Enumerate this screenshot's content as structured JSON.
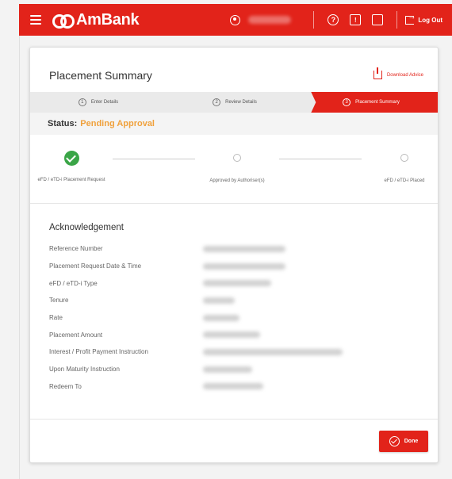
{
  "header": {
    "brand": "AmBank",
    "logout_label": "Log Out",
    "help_glyph": "?",
    "book_glyph": "!"
  },
  "page": {
    "title": "Placement Summary",
    "download_label": "Download Advice"
  },
  "stepper": [
    {
      "num": "1",
      "label": "Enter Details"
    },
    {
      "num": "2",
      "label": "Review Details"
    },
    {
      "num": "3",
      "label": "Placement Summary"
    }
  ],
  "status": {
    "label": "Status:",
    "value": "Pending Approval"
  },
  "timeline": [
    {
      "label": "eFD / eTD-i Placement Request",
      "state": "done"
    },
    {
      "label": "Approved by Authoriser(s)",
      "state": "pending"
    },
    {
      "label": "eFD / eTD-i Placed",
      "state": "pending"
    }
  ],
  "acknowledgement": {
    "title": "Acknowledgement",
    "rows": [
      {
        "label": "Reference Number"
      },
      {
        "label": "Placement Request Date & Time"
      },
      {
        "label": "eFD / eTD-i Type"
      },
      {
        "label": "Tenure"
      },
      {
        "label": "Rate"
      },
      {
        "label": "Placement Amount"
      },
      {
        "label": "Interest / Profit Payment Instruction"
      },
      {
        "label": "Upon Maturity Instruction"
      },
      {
        "label": "Redeem To"
      }
    ]
  },
  "footer": {
    "done_label": "Done"
  },
  "colors": {
    "brand_red": "#e2231a",
    "status_orange": "#f0a13c",
    "success_green": "#3aa547"
  }
}
